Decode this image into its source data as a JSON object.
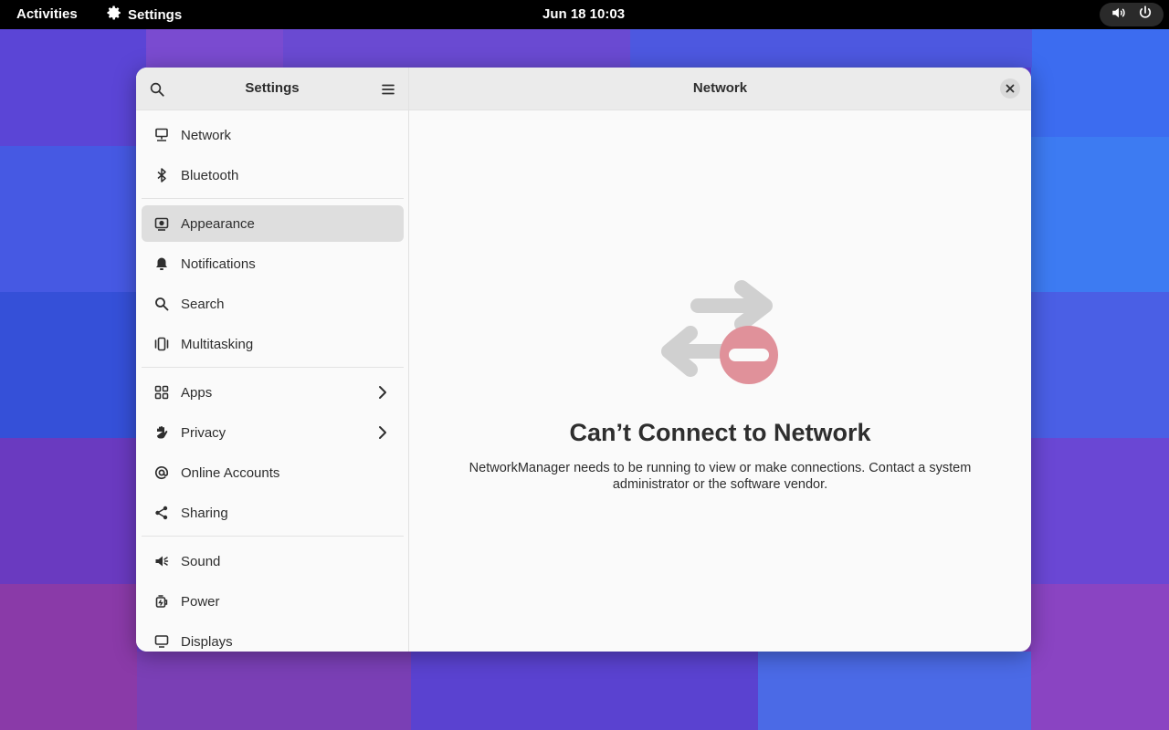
{
  "topbar": {
    "activities": "Activities",
    "app_name": "Settings",
    "clock": "Jun 18  10:03",
    "tray_icons": [
      "volume-icon",
      "power-icon"
    ]
  },
  "window": {
    "sidebar_title": "Settings",
    "content_title": "Network",
    "nav_groups": [
      [
        {
          "label": "Network",
          "icon": "network-wired-icon"
        },
        {
          "label": "Bluetooth",
          "icon": "bluetooth-icon"
        }
      ],
      [
        {
          "label": "Appearance",
          "icon": "appearance-icon",
          "selected": true
        },
        {
          "label": "Notifications",
          "icon": "bell-icon"
        },
        {
          "label": "Search",
          "icon": "search-icon"
        },
        {
          "label": "Multitasking",
          "icon": "multitasking-icon"
        }
      ],
      [
        {
          "label": "Apps",
          "icon": "apps-grid-icon",
          "has_submenu": true
        },
        {
          "label": "Privacy",
          "icon": "hand-icon",
          "has_submenu": true
        },
        {
          "label": "Online Accounts",
          "icon": "at-icon"
        },
        {
          "label": "Sharing",
          "icon": "share-icon"
        }
      ],
      [
        {
          "label": "Sound",
          "icon": "speaker-icon"
        },
        {
          "label": "Power",
          "icon": "power-plug-icon"
        },
        {
          "label": "Displays",
          "icon": "display-icon"
        }
      ]
    ],
    "status": {
      "title": "Can’t Connect to Network",
      "description": "NetworkManager needs to be running to view or make connections. Contact a system administrator or the software vendor."
    }
  },
  "colors": {
    "topbar": "#000000",
    "window_bg": "#fafafa",
    "header_bg": "#ebebeb",
    "selected": "#dedede",
    "error_badge": "#e0919a",
    "arrows": "#d0d0d0"
  }
}
